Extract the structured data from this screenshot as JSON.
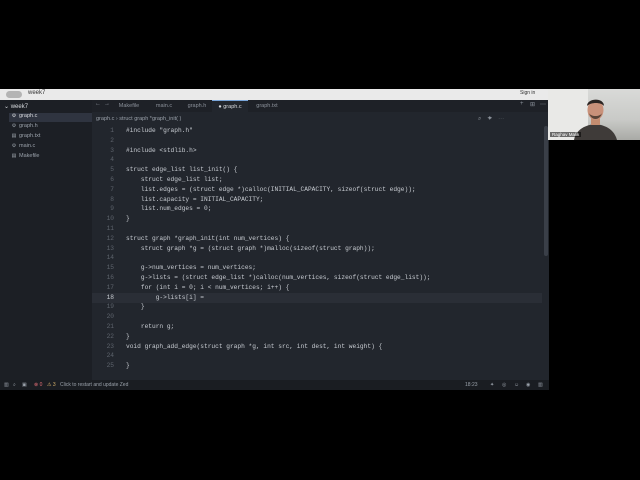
{
  "window": {
    "title": "week7",
    "sign_in": "Sign in"
  },
  "sidebar": {
    "root": "week7",
    "items": [
      {
        "label": "graph.c",
        "icon": "file-c-icon",
        "active": true
      },
      {
        "label": "graph.h",
        "icon": "file-h-icon",
        "active": false
      },
      {
        "label": "graph.txt",
        "icon": "file-text-icon",
        "active": false
      },
      {
        "label": "main.c",
        "icon": "file-c-icon",
        "active": false
      },
      {
        "label": "Makefile",
        "icon": "file-make-icon",
        "active": false
      }
    ]
  },
  "tabs": [
    {
      "label": "Makefile",
      "active": false
    },
    {
      "label": "main.c",
      "active": false
    },
    {
      "label": "graph.h",
      "active": false
    },
    {
      "label": "● graph.c",
      "active": true
    },
    {
      "label": "graph.txt",
      "active": false
    }
  ],
  "breadcrumb": "graph.c › struct graph *graph_init( )",
  "editor": {
    "current_line": 18,
    "lines": [
      {
        "n": "1",
        "text": "#include \"graph.h\""
      },
      {
        "n": "2",
        "text": ""
      },
      {
        "n": "3",
        "text": "#include <stdlib.h>"
      },
      {
        "n": "4",
        "text": ""
      },
      {
        "n": "5",
        "text": "struct edge_list list_init() {"
      },
      {
        "n": "6",
        "text": "    struct edge_list list;"
      },
      {
        "n": "7",
        "text": "    list.edges = (struct edge *)calloc(INITIAL_CAPACITY, sizeof(struct edge));"
      },
      {
        "n": "8",
        "text": "    list.capacity = INITIAL_CAPACITY;"
      },
      {
        "n": "9",
        "text": "    list.num_edges = 0;"
      },
      {
        "n": "10",
        "text": "}"
      },
      {
        "n": "11",
        "text": ""
      },
      {
        "n": "12",
        "text": "struct graph *graph_init(int num_vertices) {"
      },
      {
        "n": "13",
        "text": "    struct graph *g = (struct graph *)malloc(sizeof(struct graph));"
      },
      {
        "n": "14",
        "text": ""
      },
      {
        "n": "15",
        "text": "    g->num_vertices = num_vertices;"
      },
      {
        "n": "16",
        "text": "    g->lists = (struct edge_list *)calloc(num_vertices, sizeof(struct edge_list));"
      },
      {
        "n": "17",
        "text": "    for (int i = 0; i < num_vertices; i++) {"
      },
      {
        "n": "18",
        "text": "        g->lists[i] ="
      },
      {
        "n": "19",
        "text": "    }"
      },
      {
        "n": "20",
        "text": ""
      },
      {
        "n": "21",
        "text": "    return g;"
      },
      {
        "n": "22",
        "text": "}"
      },
      {
        "n": "23",
        "text": "void graph_add_edge(struct graph *g, int src, int dest, int weight) {"
      },
      {
        "n": "24",
        "text": ""
      },
      {
        "n": "25",
        "text": "}"
      }
    ]
  },
  "status": {
    "errors": "⊗ 0",
    "warnings": "⚠ 3",
    "update": "Click to restart and update Zed",
    "cursor": "18:23"
  },
  "webcam": {
    "name": "Raghav Malik"
  }
}
